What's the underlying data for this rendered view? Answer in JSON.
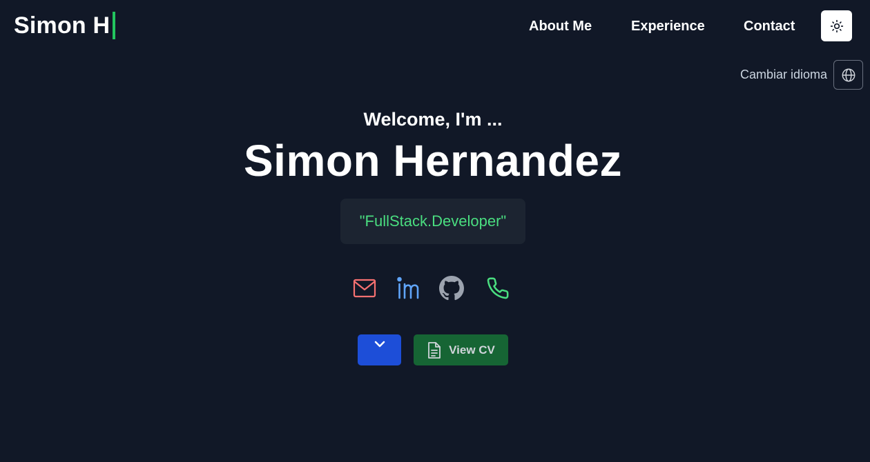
{
  "header": {
    "logo_text": "Simon H",
    "nav": {
      "about": "About Me",
      "experience": "Experience",
      "contact": "Contact"
    },
    "theme_toggle_icon": "sun-icon"
  },
  "language": {
    "label": "Cambiar idioma",
    "icon": "globe-icon"
  },
  "hero": {
    "welcome": "Welcome, I'm ...",
    "name": "Simon Hernandez",
    "role": "\"FullStack.Developer\""
  },
  "social": [
    {
      "name": "mail-icon",
      "color": "#f87171"
    },
    {
      "name": "linkedin-icon",
      "color": "#60a5fa"
    },
    {
      "name": "github-icon",
      "color": "#9ca3af"
    },
    {
      "name": "phone-icon",
      "color": "#4ade80"
    }
  ],
  "actions": {
    "scroll_icon": "chevron-down-icon",
    "cv_label": "View CV",
    "cv_icon": "document-icon"
  },
  "colors": {
    "background": "#111827",
    "accent_green": "#22c55e",
    "role_text": "#4ade80",
    "scroll_button": "#1d4ed8",
    "cv_button": "#166534"
  }
}
